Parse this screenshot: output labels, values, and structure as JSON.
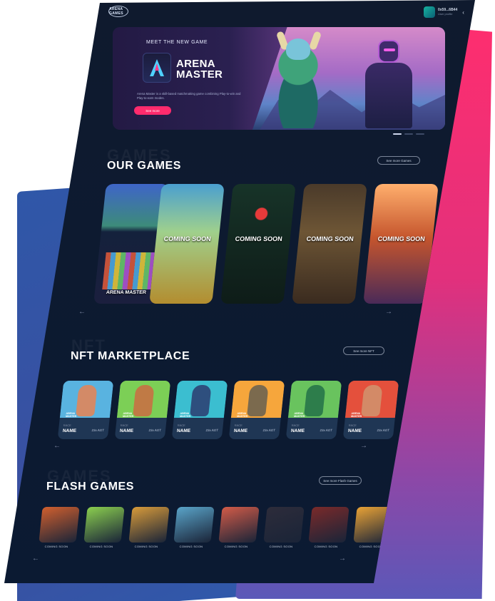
{
  "colors": {
    "accent": "#ff2b6d",
    "bg": "#0f1a2e",
    "card": "#1f3654",
    "text": "#ffffff"
  },
  "header": {
    "logo": "ARENA GAMES",
    "user_name": "0x59...6B44",
    "user_sub": "User profile"
  },
  "hero": {
    "tagline": "MEET THE NEW GAME",
    "title_line1": "ARENA",
    "title_line2": "MASTER",
    "description": "Arena Master is a skill-based matchmaking game combining Play-to-win and Play-to-earn modes.",
    "cta": "See more",
    "slides": 3,
    "active_slide": 0
  },
  "games": {
    "section_title": "OUR GAMES",
    "ghost": "GAMES",
    "see_more": "See more Games",
    "cards": [
      {
        "label": "ARENA MASTER"
      },
      {
        "label": "COMING SOON"
      },
      {
        "label": "COMING SOON"
      },
      {
        "label": "COMING SOON"
      },
      {
        "label": "COMING SOON"
      }
    ]
  },
  "nft": {
    "section_title": "NFT MARKETPLACE",
    "ghost": "NFT",
    "see_more": "See more NFT",
    "brand_line1": "ARENA",
    "brand_line2": "MASTER",
    "cards": [
      {
        "race": "RACE",
        "name": "NAME",
        "price": "23x AGT",
        "color": "#59b3e0",
        "fig": "#d38a67"
      },
      {
        "race": "RACE",
        "name": "NAME",
        "price": "23x AGT",
        "color": "#7ccf56",
        "fig": "#c07a45"
      },
      {
        "race": "RACE",
        "name": "NAME",
        "price": "23x AGT",
        "color": "#3bbed0",
        "fig": "#2e4f7e"
      },
      {
        "race": "RACE",
        "name": "NAME",
        "price": "23x AGT",
        "color": "#f6a63c",
        "fig": "#7b6a4e"
      },
      {
        "race": "RACE",
        "name": "NAME",
        "price": "23x AGT",
        "color": "#69c35e",
        "fig": "#2d7d4b"
      },
      {
        "race": "RACE",
        "name": "NAME",
        "price": "23x AGT",
        "color": "#e4503c",
        "fig": "#d38a67"
      }
    ]
  },
  "flash": {
    "section_title": "FLASH GAMES",
    "ghost": "GAMES",
    "see_more": "See more Flash Games",
    "cards": [
      {
        "label": "COMING SOON",
        "color": "#d05f2e"
      },
      {
        "label": "COMING SOON",
        "color": "#8bcf4f"
      },
      {
        "label": "COMING SOON",
        "color": "#d79a3a"
      },
      {
        "label": "COMING SOON",
        "color": "#5aa4c9"
      },
      {
        "label": "COMING SOON",
        "color": "#d25b48"
      },
      {
        "label": "COMING SOON",
        "color": "#2d2c3a"
      },
      {
        "label": "COMING SOON",
        "color": "#7a2a2a"
      },
      {
        "label": "COMING SOON",
        "color": "#e9a236"
      }
    ]
  }
}
